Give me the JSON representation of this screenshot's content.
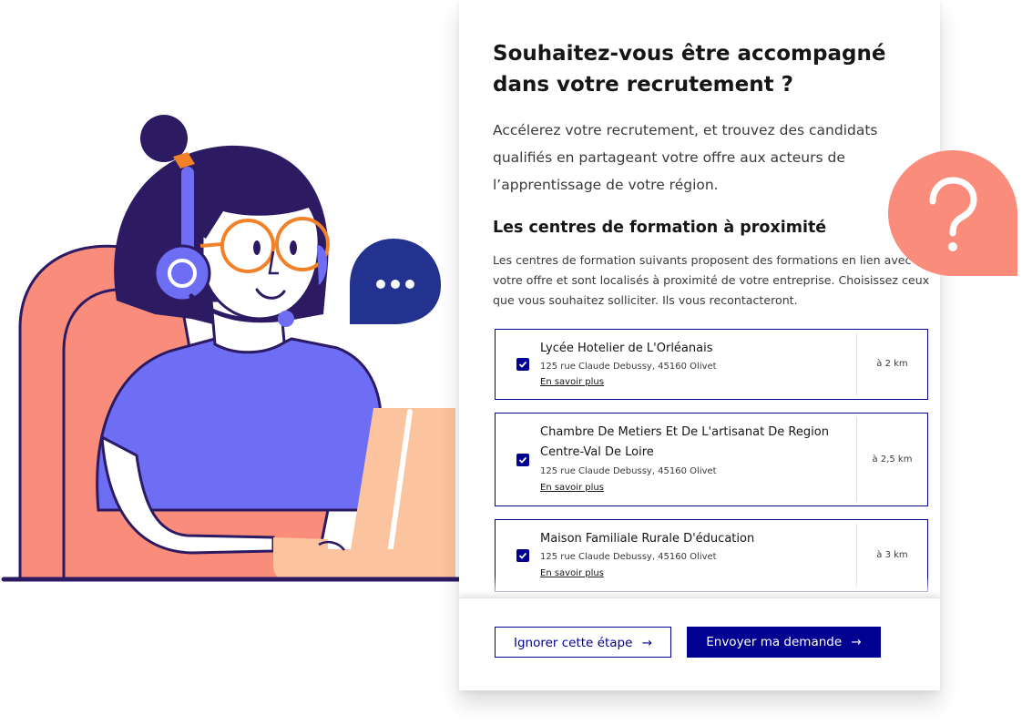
{
  "modal": {
    "title": "Souhaitez-vous être accompagné dans votre recrutement ?",
    "intro": "Accélerez votre recrutement, et trouvez des candidats qualifiés en partageant votre offre aux acteurs de l’apprentissage de votre région.",
    "section_title": "Les centres de formation à proximité",
    "section_desc": "Les centres de formation suivants proposent des formations en lien avec votre offre et sont localisés à proximité de votre entreprise. Choisissez ceux que vous souhaitez solliciter. Ils vous recontacteront."
  },
  "centres": [
    {
      "name": "Lycée Hotelier de L'Orléanais",
      "address": "125 rue Claude Debussy, 45160 Olivet",
      "link": "En savoir plus",
      "distance": "à 2 km",
      "checked": true
    },
    {
      "name": "Chambre De Metiers Et De L'artisanat De Region Centre-Val De Loire",
      "address": "125 rue Claude Debussy, 45160 Olivet",
      "link": "En savoir plus",
      "distance": "à 2,5 km",
      "checked": true
    },
    {
      "name": "Maison Familiale Rurale D'éducation",
      "address": "125 rue Claude Debussy, 45160 Olivet",
      "link": "En savoir plus",
      "distance": "à 3 km",
      "checked": true
    }
  ],
  "footer": {
    "skip_label": "Ignorer cette étape",
    "send_label": "Envoyer ma demande",
    "arrow": "→"
  },
  "icons": {
    "chat_bubble": "chat-dots-icon",
    "question_bubble": "question-mark-icon",
    "checkbox": "checkmark-icon"
  },
  "colors": {
    "primary": "#000091",
    "coral": "#FA8C7C",
    "violet": "#6E6EF5",
    "dark_purple": "#2C1A62",
    "orange": "#F28229",
    "skin": "#FBC49E",
    "chat_blue": "#23318F"
  }
}
